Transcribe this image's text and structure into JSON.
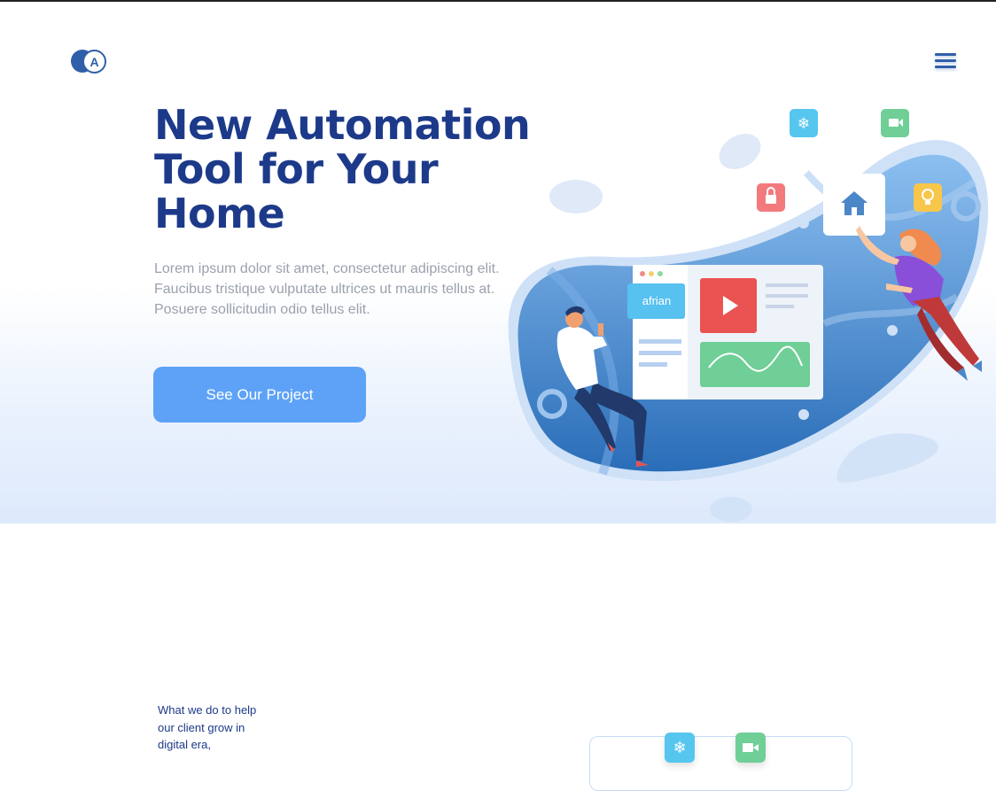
{
  "header": {
    "logo_letter": "A",
    "menu_icon": "hamburger-menu-icon"
  },
  "hero": {
    "title": "New Automation Tool for Your Home",
    "description": "Lorem ipsum dolor sit amet, consectetur adipiscing elit. Faucibus tristique vulputate ultrices ut mauris tellus at. Posuere sollicitudin odio tellus elit.",
    "cta_label": "See Our Project"
  },
  "illustration": {
    "card_label": "afrian",
    "icons": [
      "snowflake-icon",
      "video-camera-icon",
      "lock-icon",
      "home-icon",
      "lightbulb-icon",
      "play-icon"
    ]
  },
  "section2": {
    "intro": "What we do to help our client grow in digital era,",
    "icons": [
      "snowflake-icon",
      "video-camera-icon"
    ]
  },
  "colors": {
    "brand": "#1d3a8a",
    "accent": "#5ea2f7",
    "text_muted": "#9aa1ad"
  }
}
